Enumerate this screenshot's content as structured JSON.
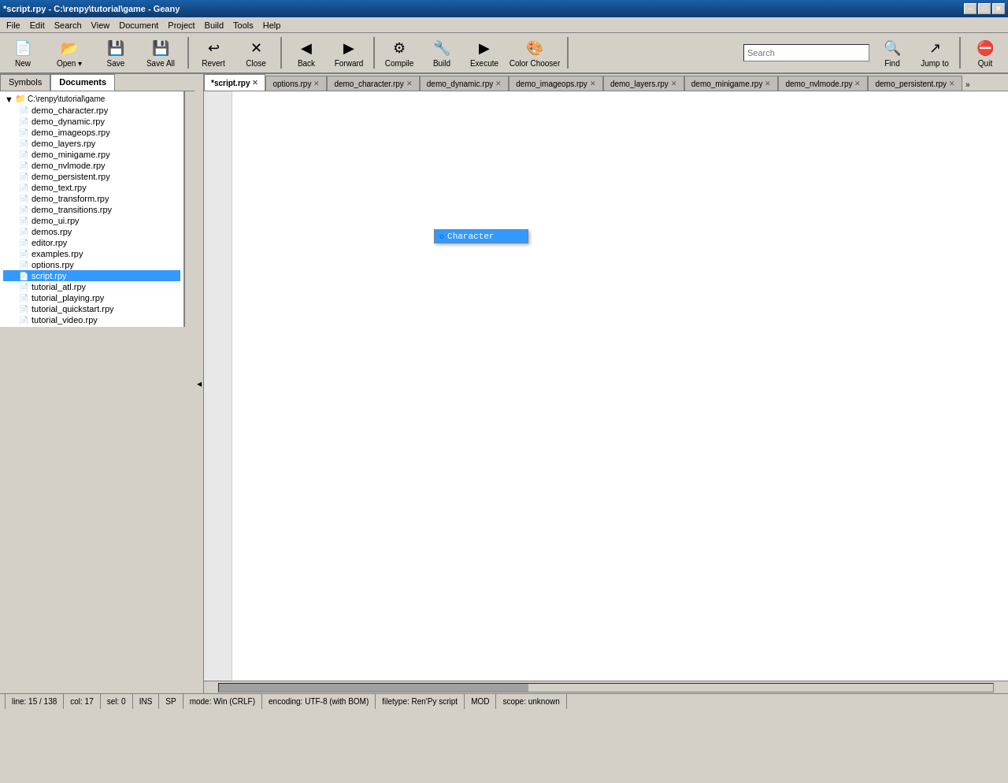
{
  "window": {
    "title": "*script.rpy - C:\\renpy\\tutorial\\game - Geany"
  },
  "title_controls": [
    "─",
    "□",
    "✕"
  ],
  "menu": {
    "items": [
      "File",
      "Edit",
      "Search",
      "View",
      "Document",
      "Project",
      "Build",
      "Tools",
      "Help"
    ]
  },
  "toolbar": {
    "buttons": [
      {
        "label": "New",
        "icon": "📄"
      },
      {
        "label": "Open",
        "icon": "📂"
      },
      {
        "label": "Save",
        "icon": "💾"
      },
      {
        "label": "Save All",
        "icon": "💾"
      },
      {
        "label": "Revert",
        "icon": "↩"
      },
      {
        "label": "Close",
        "icon": "✕"
      },
      {
        "label": "Back",
        "icon": "◀"
      },
      {
        "label": "Forward",
        "icon": "▶"
      },
      {
        "label": "Compile",
        "icon": "⚙"
      },
      {
        "label": "Build",
        "icon": "🔨"
      },
      {
        "label": "Execute",
        "icon": "▶"
      },
      {
        "label": "Color Chooser",
        "icon": "🎨"
      },
      {
        "label": "Find",
        "icon": "🔍"
      },
      {
        "label": "Jump to",
        "icon": "↗"
      },
      {
        "label": "Quit",
        "icon": "⛔"
      }
    ],
    "search_placeholder": "Search"
  },
  "panel_tabs": [
    "Symbols",
    "Documents"
  ],
  "sidebar": {
    "root_label": "C:\\renpy\\tutorial\\game",
    "files": [
      "demo_character.rpy",
      "demo_dynamic.rpy",
      "demo_imageops.rpy",
      "demo_layers.rpy",
      "demo_minigame.rpy",
      "demo_nvlmode.rpy",
      "demo_persistent.rpy",
      "demo_text.rpy",
      "demo_transform.rpy",
      "demo_transitions.rpy",
      "demo_ui.rpy",
      "demos.rpy",
      "editor.rpy",
      "examples.rpy",
      "options.rpy",
      "script.rpy",
      "tutorial_atl.rpy",
      "tutorial_playing.rpy",
      "tutorial_quickstart.rpy",
      "tutorial_video.rpy"
    ],
    "selected_file": "script.rpy"
  },
  "file_tabs": [
    {
      "name": "script.rpy",
      "active": true
    },
    {
      "name": "options.rpy",
      "active": false
    },
    {
      "name": "demo_character.rpy",
      "active": false
    },
    {
      "name": "demo_dynamic.rpy",
      "active": false
    },
    {
      "name": "demo_imageops.rpy",
      "active": false
    },
    {
      "name": "demo_layers.rpy",
      "active": false
    },
    {
      "name": "demo_minigame.rpy",
      "active": false
    },
    {
      "name": "demo_nvlmode.rpy",
      "active": false
    },
    {
      "name": "demo_persistent.rpy",
      "active": false
    }
  ],
  "autocomplete": {
    "items": [
      {
        "label": "Character",
        "icon": "◇"
      }
    ]
  },
  "status": {
    "line": "line: 15 / 138",
    "col": "col: 17",
    "sel": "sel: 0",
    "ins": "INS",
    "sp": "SP",
    "mode": "mode: Win (CRLF)",
    "encoding": "encoding: UTF-8 (with BOM)",
    "filetype": "filetype: Ren'Py script",
    "mod": "MOD",
    "scope": "scope: unknown"
  }
}
